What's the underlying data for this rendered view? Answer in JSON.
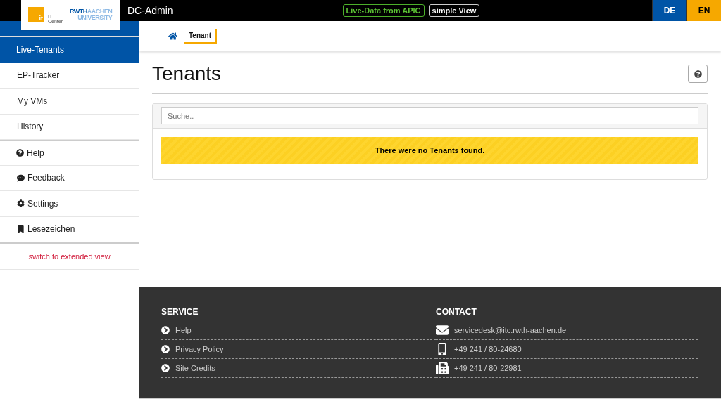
{
  "header": {
    "logo": {
      "mark": "it",
      "sub": "IT Center",
      "line1a": "RWTH",
      "line1b": "AACHEN",
      "line2": "UNIVERSITY"
    },
    "title": "DC-Admin",
    "badges": [
      {
        "label": "Live-Data from APIC",
        "kind": "live"
      },
      {
        "label": "simple View",
        "kind": "view"
      }
    ],
    "languages": [
      {
        "label": "DE",
        "color": "#0054a6"
      },
      {
        "label": "EN",
        "color": "#f6a800"
      }
    ]
  },
  "sidebar": {
    "items": [
      {
        "label": "Live-Tenants",
        "kind": "page",
        "selected": true
      },
      {
        "label": "EP-Tracker",
        "kind": "page",
        "selected": false
      },
      {
        "label": "My VMs",
        "kind": "page",
        "selected": false
      },
      {
        "label": "History",
        "kind": "page",
        "selected": false
      },
      {
        "label": "Help",
        "kind": "help",
        "selected": false
      },
      {
        "label": "Feedback",
        "kind": "feedback",
        "selected": false
      },
      {
        "label": "Settings",
        "kind": "settings",
        "selected": false
      },
      {
        "label": "Lesezeichen",
        "kind": "bookmark",
        "selected": false
      }
    ],
    "switch_link": "switch to extended view"
  },
  "breadcrumb": [
    "Tenant"
  ],
  "page": {
    "title": "Tenants",
    "search": {
      "placeholder": "Suche.."
    },
    "message": "There were no Tenants found."
  },
  "footer": {
    "service": {
      "title": "SERVICE",
      "links": [
        "Help",
        "Privacy Policy",
        "Site Credits"
      ]
    },
    "contact": {
      "title": "CONTACT",
      "items": [
        {
          "kind": "mail",
          "text": "servicedesk@itc.rwth-aachen.de"
        },
        {
          "kind": "phone",
          "text": "+49 241 / 80-24680"
        },
        {
          "kind": "fax",
          "text": "+49 241 / 80-22981"
        }
      ]
    }
  }
}
